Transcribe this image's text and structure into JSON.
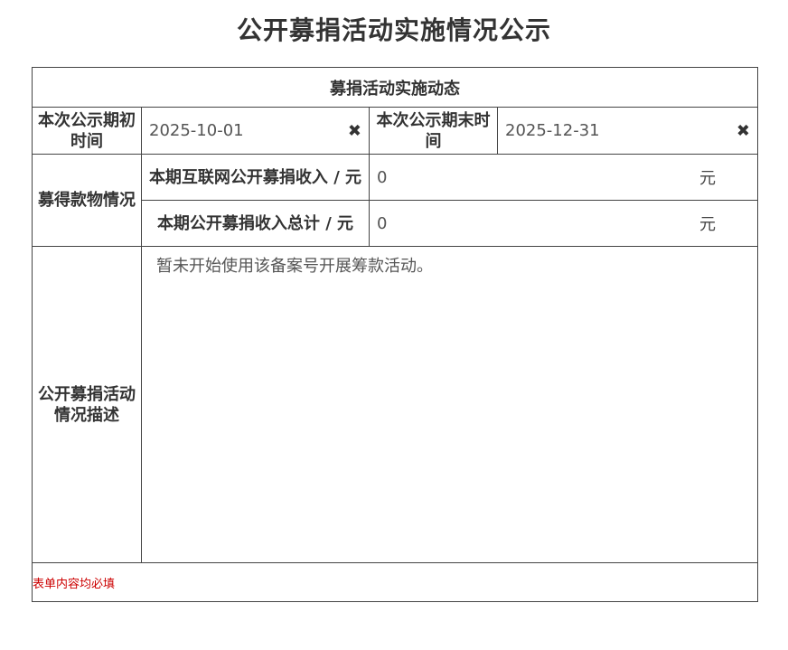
{
  "page": {
    "title": "公开募捐活动实施情况公示"
  },
  "section": {
    "title": "募捐活动实施动态"
  },
  "period": {
    "start_label": "本次公示期初时间",
    "start_value": "2025-10-01",
    "end_label": "本次公示期末时间",
    "end_value": "2025-12-31",
    "clear_icon": "✖"
  },
  "income": {
    "group_label": "募得款物情况",
    "internet_label": "本期互联网公开募捐收入 / 元",
    "internet_value": "0",
    "total_label": "本期公开募捐收入总计 / 元",
    "total_value": "0",
    "unit": "元"
  },
  "description": {
    "label": "公开募捐活动情况描述",
    "value": "暂未开始使用该备案号开展筹款活动。"
  },
  "footer": {
    "note": "表单内容均必填"
  },
  "icons": {
    "clear": "close-icon"
  },
  "colors": {
    "note": "#cc0000",
    "border": "#444444"
  }
}
